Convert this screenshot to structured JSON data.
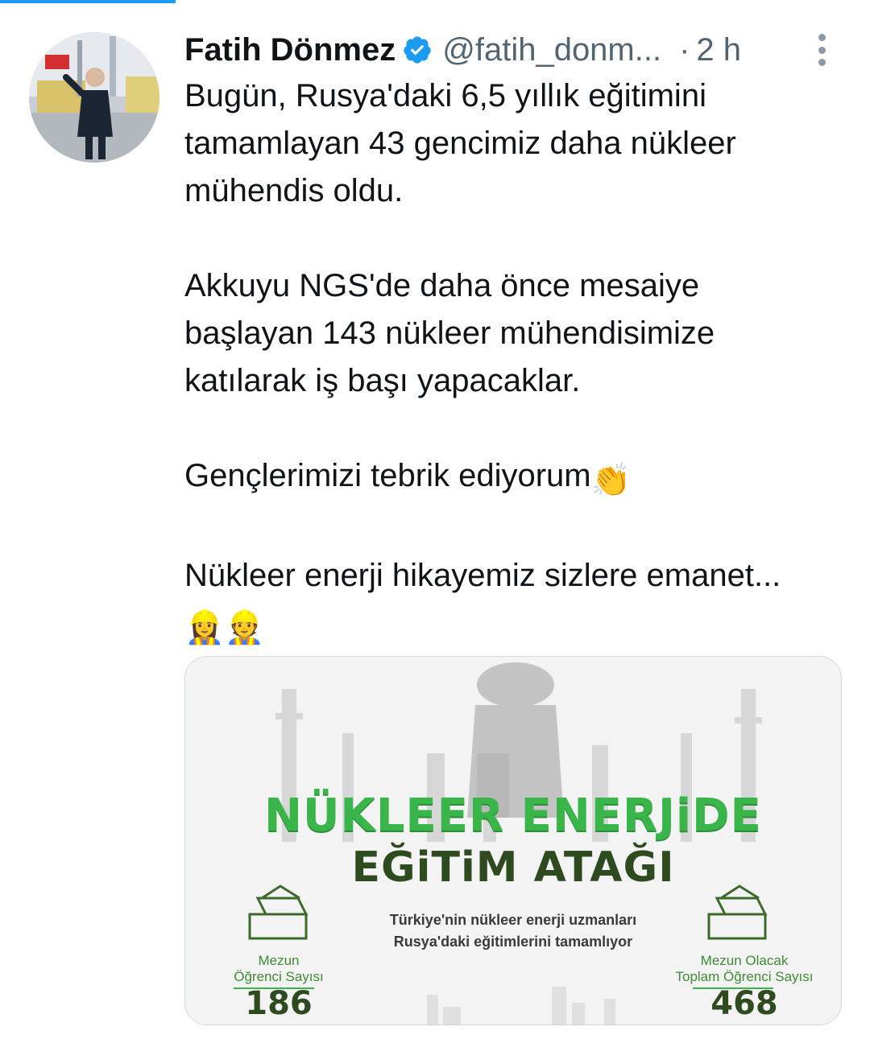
{
  "tweet": {
    "author": {
      "name": "Fatih Dönmez",
      "handle": "@fatih_donm...",
      "verified": true
    },
    "separator": "·",
    "time": "2 h",
    "paragraphs": [
      "Bugün, Rusya'daki 6,5 yıllık eğitimini tamamlayan 43 gencimiz daha nükleer mühendis oldu.",
      "Akkuyu NGS'de daha önce mesaiye başlayan 143 nükleer mühendisimize katılarak iş başı yapacaklar.",
      "Gençlerimizi tebrik ediyorum",
      "Nükleer enerji hikayemiz sizlere emanet..."
    ],
    "emojis": {
      "clap": "👏",
      "workers": "👷‍♀️👷"
    }
  },
  "media": {
    "headline_line1": "NÜKLEER ENERJiDE",
    "headline_line2": "EĞiTiM ATAĞI",
    "subtitle_line1": "Türkiye'nin nükleer enerji uzmanları",
    "subtitle_line2": "Rusya'daki eğitimlerini tamamlıyor",
    "stat_left": {
      "label_line1": "Mezun",
      "label_line2": "Öğrenci Sayısı",
      "value": "186"
    },
    "stat_right": {
      "label_line1": "Mezun Olacak",
      "label_line2": "Toplam Öğrenci Sayısı",
      "value": "468"
    },
    "colors": {
      "green": "#39b54a",
      "dark_green": "#2e4a1f"
    }
  },
  "colors": {
    "accent": "#1d9bf0",
    "text": "#0f1419",
    "muted": "#536471"
  }
}
